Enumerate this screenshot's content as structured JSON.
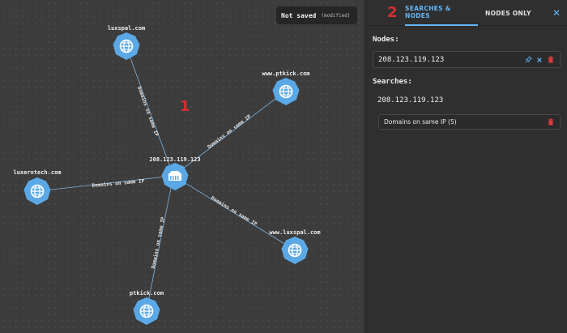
{
  "status": {
    "main": "Not saved",
    "sub": "(modified)"
  },
  "markers": {
    "canvas": "1",
    "panel": "2"
  },
  "graph": {
    "center": {
      "label": "208.123.119.123",
      "icon": "server-icon"
    },
    "nodes": [
      {
        "label": "luxspal.com",
        "icon": "globe-icon"
      },
      {
        "label": "www.ptkick.com",
        "icon": "globe-icon"
      },
      {
        "label": "luxerntech.com",
        "icon": "globe-icon"
      },
      {
        "label": "www.luxspal.com",
        "icon": "globe-icon"
      },
      {
        "label": "ptkick.com",
        "icon": "globe-icon"
      }
    ],
    "edge_label": "Domains on same IP"
  },
  "panel": {
    "tabs": [
      {
        "label": "SEARCHES & NODES",
        "active": true
      },
      {
        "label": "NODES ONLY",
        "active": false
      }
    ],
    "close_icon": "close-icon",
    "nodes_heading": "Nodes:",
    "node_entry": "208.123.119.123",
    "searches_heading": "Searches:",
    "search_ip": "208.123.119.123",
    "search_item": "Domains on same IP (5)"
  },
  "colors": {
    "accent": "#64b5f6",
    "node_fill": "#5aa9e6",
    "delete": "#e53935",
    "marker": "#d32f2f"
  }
}
